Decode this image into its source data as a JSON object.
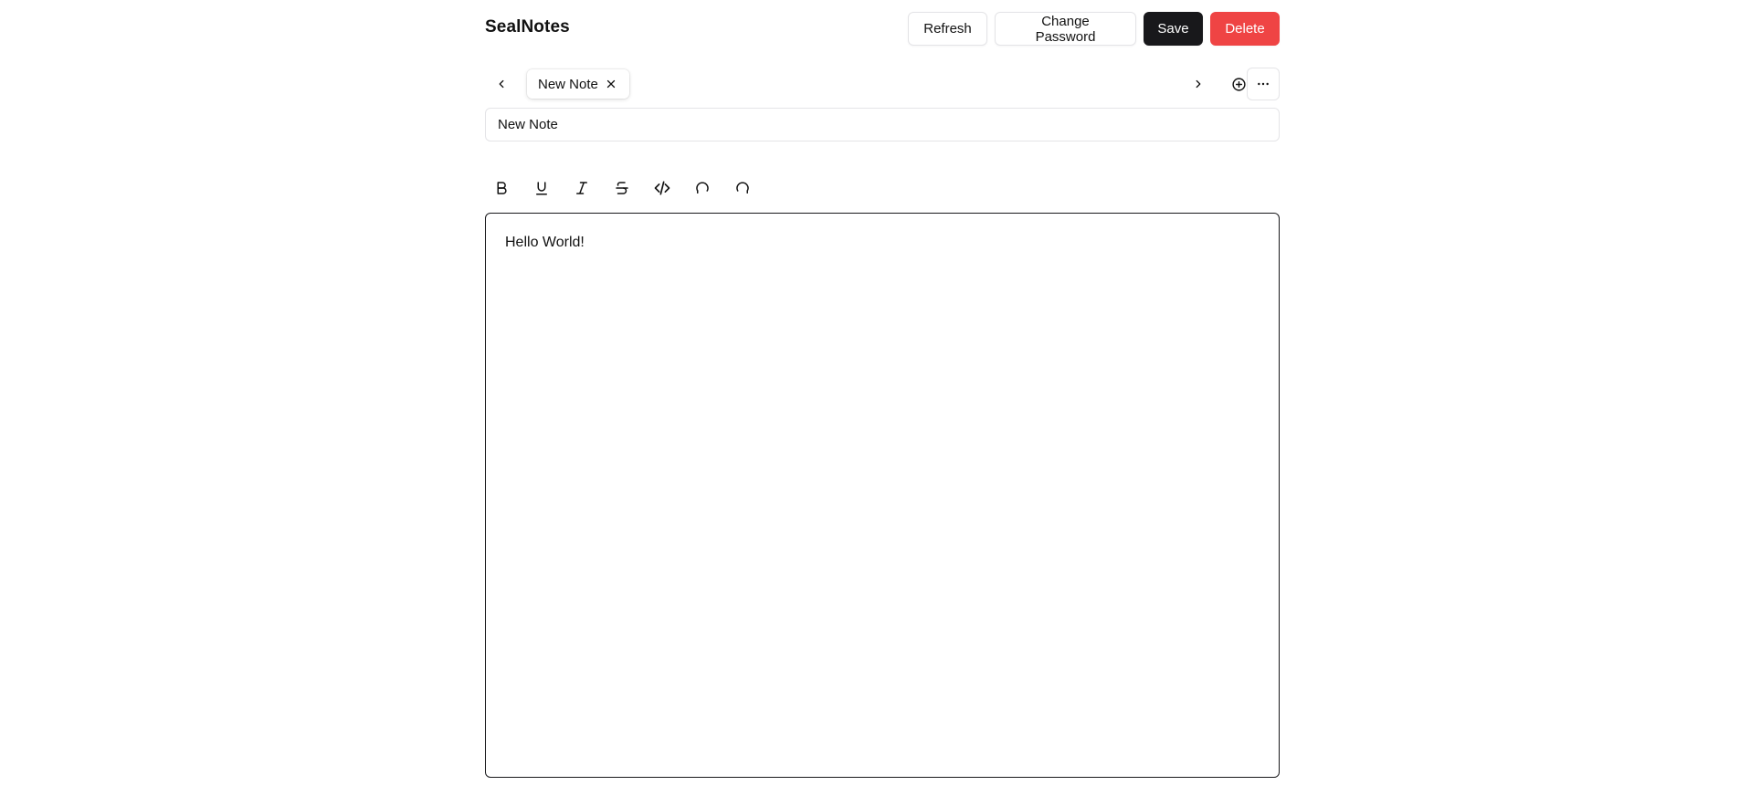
{
  "header": {
    "brand": "SealNotes",
    "refresh_label": "Refresh",
    "change_password_label": "Change Password",
    "save_label": "Save",
    "delete_label": "Delete"
  },
  "tabs": {
    "items": [
      {
        "label": "New Note",
        "active": true
      }
    ],
    "prev_icon": "chevron-left-icon",
    "next_icon": "chevron-right-icon",
    "add_icon": "plus-circle-icon",
    "more_icon": "ellipsis-icon"
  },
  "note": {
    "title_value": "New Note",
    "content": "Hello World!"
  },
  "toolbar": {
    "tools": [
      "bold",
      "underline",
      "italic",
      "strikethrough",
      "code",
      "undo",
      "redo"
    ]
  },
  "colors": {
    "primary": "#18181b",
    "danger": "#ef4444",
    "border": "#e4e4e7",
    "background": "#ffffff"
  }
}
